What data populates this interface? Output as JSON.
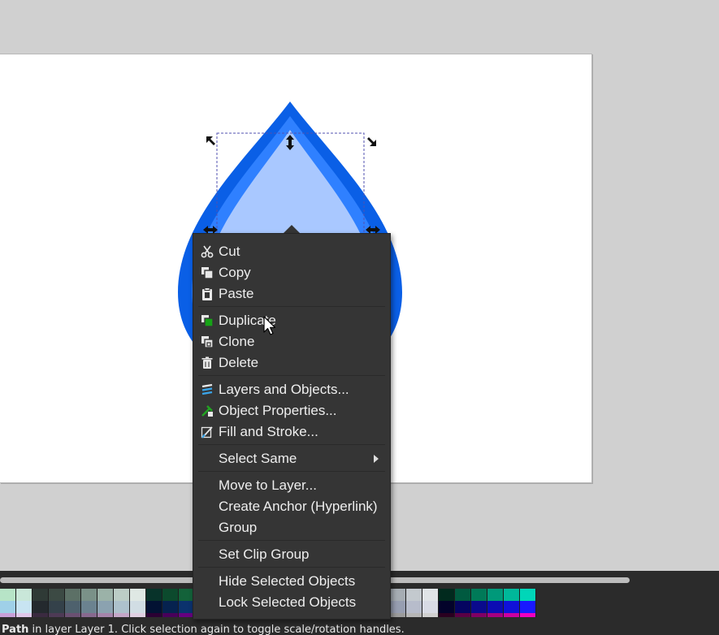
{
  "context_menu": {
    "groups": [
      [
        {
          "label": "Cut",
          "icon": "scissors-icon"
        },
        {
          "label": "Copy",
          "icon": "copy-icon"
        },
        {
          "label": "Paste",
          "icon": "paste-icon"
        }
      ],
      [
        {
          "label": "Duplicate",
          "icon": "duplicate-icon"
        },
        {
          "label": "Clone",
          "icon": "clone-icon"
        },
        {
          "label": "Delete",
          "icon": "trash-icon"
        }
      ],
      [
        {
          "label": "Layers and Objects...",
          "icon": "layers-icon"
        },
        {
          "label": "Object Properties...",
          "icon": "object-properties-icon"
        },
        {
          "label": "Fill and Stroke...",
          "icon": "fill-stroke-icon"
        }
      ],
      [
        {
          "label": "Select Same",
          "icon": "",
          "submenu": true
        }
      ],
      [
        {
          "label": "Move to Layer...",
          "icon": ""
        },
        {
          "label": "Create Anchor (Hyperlink)",
          "icon": ""
        },
        {
          "label": "Group",
          "icon": ""
        }
      ],
      [
        {
          "label": "Set Clip Group",
          "icon": ""
        }
      ],
      [
        {
          "label": "Hide Selected Objects",
          "icon": ""
        },
        {
          "label": "Lock Selected Objects",
          "icon": ""
        }
      ]
    ]
  },
  "canvas": {
    "object": "teardrop-shape",
    "colors": {
      "outer": "#0a5fe6",
      "middle": "#2f80ff",
      "inner": "#a9c8ff"
    }
  },
  "status_bar": {
    "text_bold": "Path",
    "text": " in layer Layer 1. Click selection again to toggle scale/rotation handles."
  },
  "palette": {
    "row1": [
      "#b7e4c7",
      "#c9e7d9",
      "#2f3a36",
      "#3c4a44",
      "#5c7066",
      "#7a9188",
      "#9bb2a8",
      "#bccdc6",
      "#dfe8e4",
      "#08332a",
      "#0c4a2d",
      "#13623a",
      "#1a7a44",
      "#2a9455",
      "#3cad67",
      "#56c27c",
      "#7fd59a",
      "#a8e5bb",
      "#cdeed8",
      "#2a2a2a",
      "#3b3f43",
      "#555a5f",
      "#6f757b",
      "#8a9198",
      "#a6adb3",
      "#c3c9ce",
      "#e0e4e7",
      "#012a1e",
      "#005a40",
      "#007a58",
      "#00997a",
      "#00b89a",
      "#00d6b8"
    ],
    "row2": [
      "#9fd0e8",
      "#c8e4f2",
      "#24292e",
      "#34414a",
      "#4e616d",
      "#6b8290",
      "#8ba2b0",
      "#adc1cc",
      "#d1dde4",
      "#021233",
      "#06224f",
      "#0b326d",
      "#11448c",
      "#1b58a8",
      "#2e6fc3",
      "#4d8ad6",
      "#76a7e4",
      "#a3c4ef",
      "#d2e2f8",
      "#1d1f24",
      "#2f3340",
      "#464c5c",
      "#5e6579",
      "#7a8196",
      "#979eb1",
      "#b7bccb",
      "#d8dbe5",
      "#03032a",
      "#050560",
      "#0a0a8c",
      "#0c0cb3",
      "#1010d9",
      "#1919ff"
    ],
    "row3": [
      "#c8a0d8",
      "#e0c8ea",
      "#3a2a40",
      "#4d3a55",
      "#6a5072",
      "#87698f",
      "#a585ab",
      "#c4a7c8",
      "#e0cfe2",
      "#2a0033",
      "#48005a",
      "#660080",
      "#8400a6",
      "#a300cc",
      "#c21aeb",
      "#d24ef0",
      "#e07df5",
      "#eeaaf9",
      "#f6d4fc",
      "#1f1f1f",
      "#343434",
      "#4e4e4e",
      "#686868",
      "#828282",
      "#9c9c9c",
      "#b6b6b6",
      "#d0d0d0",
      "#2a0020",
      "#5a0045",
      "#800064",
      "#a60080",
      "#cc00a0",
      "#f000c0"
    ]
  }
}
